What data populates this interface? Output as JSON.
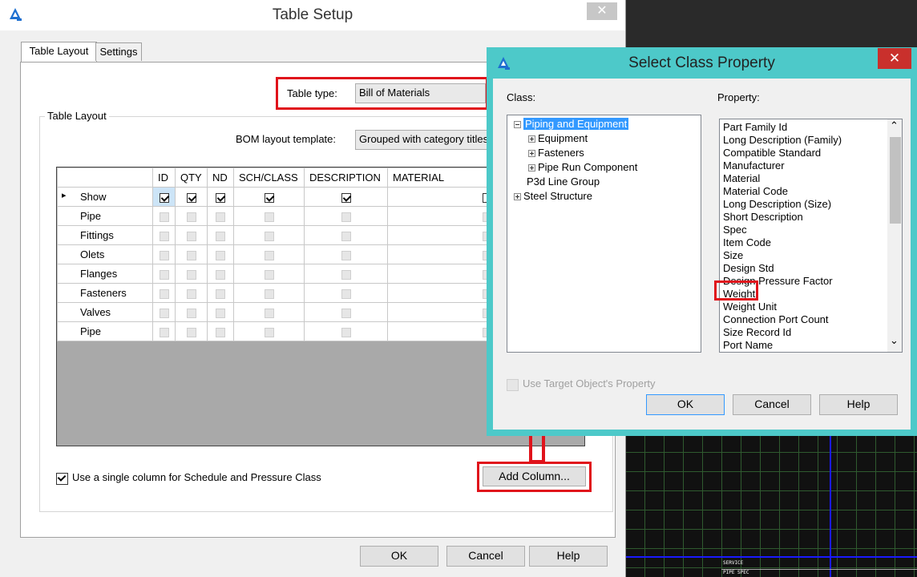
{
  "table_setup": {
    "title": "Table Setup",
    "close_glyph": "✕",
    "tabs": [
      "Table Layout",
      "Settings"
    ],
    "table_type_label": "Table type:",
    "table_type_value": "Bill of Materials",
    "group_label": "Table Layout",
    "bom_template_label": "BOM layout template:",
    "bom_template_value": "Grouped with category titles",
    "columns": [
      "ID",
      "QTY",
      "ND",
      "SCH/CLASS",
      "DESCRIPTION",
      "MATERIAL"
    ],
    "rows": [
      {
        "label": "Show",
        "enabled": true
      },
      {
        "label": "Pipe",
        "enabled": false
      },
      {
        "label": "Fittings",
        "enabled": false
      },
      {
        "label": "Olets",
        "enabled": false
      },
      {
        "label": "Flanges",
        "enabled": false
      },
      {
        "label": "Fasteners",
        "enabled": false
      },
      {
        "label": "Valves",
        "enabled": false
      },
      {
        "label": "Pipe",
        "enabled": false
      }
    ],
    "single_column_label": "Use a single column for Schedule and Pressure Class",
    "single_column_checked": true,
    "add_column_label": "Add Column...",
    "ok_label": "OK",
    "cancel_label": "Cancel",
    "help_label": "Help"
  },
  "select_class_property": {
    "title": "Select Class Property",
    "close_glyph": "✕",
    "class_label": "Class:",
    "property_label": "Property:",
    "tree": {
      "root": "Piping and Equipment",
      "children": [
        "Equipment",
        "Fasteners",
        "Pipe Run Component"
      ],
      "siblings": [
        "P3d Line Group",
        "Steel Structure"
      ]
    },
    "properties": [
      "Part Family Id",
      "Long Description (Family)",
      "Compatible Standard",
      "Manufacturer",
      "Material",
      "Material Code",
      "Long Description (Size)",
      "Short Description",
      "Spec",
      "Item Code",
      "Size",
      "Design Std",
      "Design Pressure Factor",
      "Weight",
      "Weight Unit",
      "Connection Port Count",
      "Size Record Id",
      "Port Name"
    ],
    "use_target_label": "Use Target Object's Property",
    "ok_label": "OK",
    "cancel_label": "Cancel",
    "help_label": "Help",
    "scroll_up_glyph": "⌃",
    "scroll_down_glyph": "⌄"
  },
  "cad_text": {
    "label_1": "SERVICE",
    "label_2": "PIPE SPEC"
  },
  "colors": {
    "highlight_red": "#e0131b",
    "dialog_teal": "#4dc9c9",
    "selection_blue": "#3399ff"
  }
}
